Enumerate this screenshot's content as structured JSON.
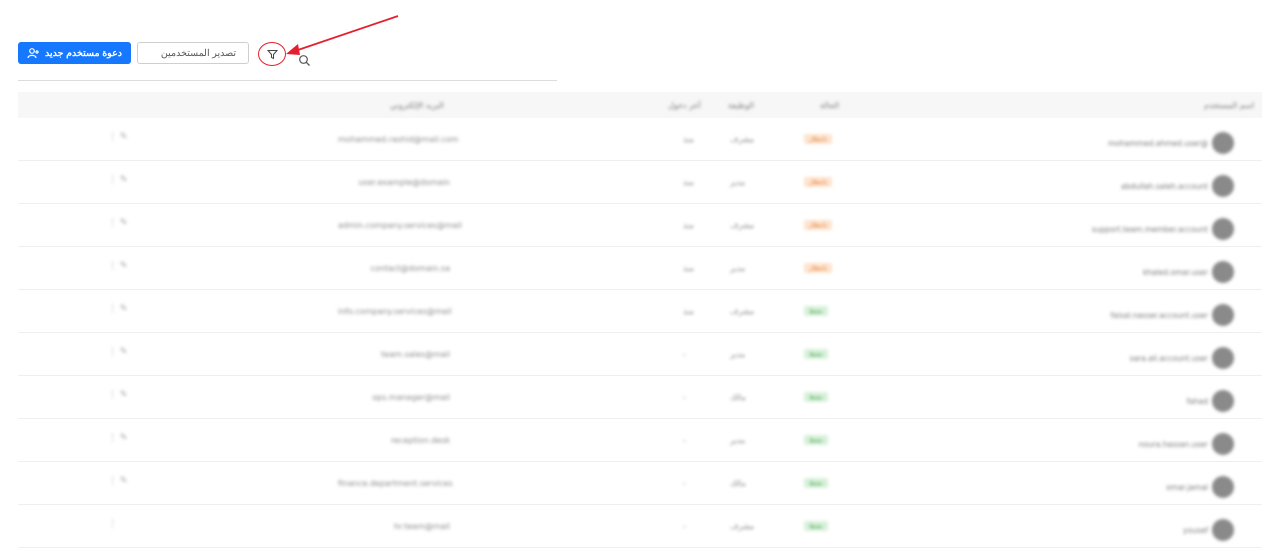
{
  "toolbar": {
    "invite_label": "دعوة مستخدم جديد",
    "export_label": "تصدير المستخدمين",
    "filter_icon": "filter-icon",
    "search_icon": "search-icon"
  },
  "table": {
    "headers": {
      "user": "اسم المستخدم",
      "status": "الحالة",
      "role": "الوظيفة",
      "last_login": "آخر دخول",
      "email": "البريد الإلكتروني"
    },
    "rows": [
      {
        "user": "mohammed.ahmed.user@",
        "status": "بانتظار",
        "status_kind": "pending",
        "role": "مشرف",
        "last": "منذ",
        "email": "mohammed.rashid@mail.com",
        "actions": "⋮  ✎"
      },
      {
        "user": "abdullah.saleh.account",
        "status": "بانتظار",
        "status_kind": "pending",
        "role": "مدير",
        "last": "منذ",
        "email": "user.example@domain",
        "actions": "⋮  ✎"
      },
      {
        "user": "support.team.member.account",
        "status": "بانتظار",
        "status_kind": "pending",
        "role": "مشرف",
        "last": "منذ",
        "email": "admin.company.services@mail",
        "actions": "⋮  ✎"
      },
      {
        "user": "khaled.omar.user",
        "status": "بانتظار",
        "status_kind": "pending",
        "role": "مدير",
        "last": "منذ",
        "email": "contact@domain.sa",
        "actions": "⋮  ✎"
      },
      {
        "user": "faisal.nasser.account.user",
        "status": "نشط",
        "status_kind": "active",
        "role": "مشرف",
        "last": "منذ",
        "email": "info.company.services@mail",
        "actions": "⋮  ✎"
      },
      {
        "user": "sara.ali.account.user",
        "status": "نشط",
        "status_kind": "active",
        "role": "مدير",
        "last": "-",
        "email": "team.sales@mail",
        "actions": "⋮  ✎"
      },
      {
        "user": "fahad",
        "status": "نشط",
        "status_kind": "active",
        "role": "مالك",
        "last": "-",
        "email": "ops.manager@mail",
        "actions": "⋮  ✎"
      },
      {
        "user": "noura.hassan.user",
        "status": "نشط",
        "status_kind": "active",
        "role": "مدير",
        "last": "-",
        "email": "reception.desk",
        "actions": "⋮  ✎"
      },
      {
        "user": "omar.jamal",
        "status": "نشط",
        "status_kind": "active",
        "role": "مالك",
        "last": "-",
        "email": "finance.department.services",
        "actions": "⋮  ✎"
      },
      {
        "user": "yousef",
        "status": "نشط",
        "status_kind": "active",
        "role": "مشرف",
        "last": "-",
        "email": "hr.team@mail",
        "actions": "⋮"
      }
    ]
  },
  "colors": {
    "primary": "#1677ff",
    "annotation": "#e4202e",
    "pending_bg": "#fde4cf",
    "active_bg": "#d8f1da"
  }
}
